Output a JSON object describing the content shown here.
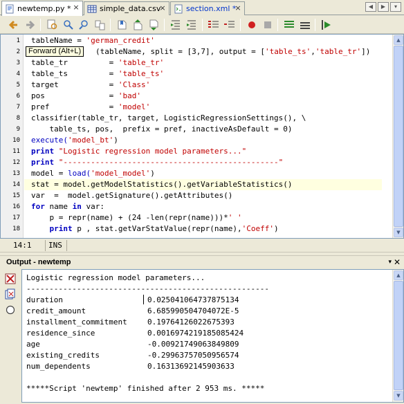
{
  "tabs": [
    {
      "label": "newtemp.py *",
      "icon": "python-file-icon"
    },
    {
      "label": "simple_data.csv",
      "icon": "table-file-icon"
    },
    {
      "label": "section.xml *",
      "icon": "xml-file-icon"
    }
  ],
  "tab_nav": {
    "prev": "◀",
    "next": "▶",
    "list": "▾"
  },
  "tooltip": "Forward (Alt+L)",
  "line_numbers": [
    "1",
    "2",
    "3",
    "4",
    "5",
    "6",
    "7",
    "8",
    "9",
    "10",
    "11",
    "12",
    "13",
    "14",
    "15",
    "16",
    "17",
    "18"
  ],
  "code": {
    "l1a": "tableName = ",
    "l1b": "'german_credit'",
    "l2a": "(tableName, split = [3,7], output = [",
    "l2b": "'table_ts'",
    "l2c": ",",
    "l2d": "'table_tr'",
    "l2e": "])",
    "l3a": "table_tr         = ",
    "l3b": "'table_tr'",
    "l4a": "table_ts         = ",
    "l4b": "'table_ts'",
    "l5a": "target           = ",
    "l5b": "'Class'",
    "l6a": "pos              = ",
    "l6b": "'bad'",
    "l7a": "pref             = ",
    "l7b": "'model'",
    "l8": "classifier(table_tr, target, LogisticRegressionSettings(), \\",
    "l9": "    table_ts, pos,  prefix = pref, inactiveAsDefault = 0)",
    "l10a": "execute(",
    "l10b": "'model_bt'",
    "l10c": ")",
    "l11a": "print",
    "l11b": " ",
    "l11c": "\"Logistic regression model parameters...\"",
    "l12a": "print",
    "l12b": " ",
    "l12c": "\"-----------------------------------------------\"",
    "l13a": "model = ",
    "l13b": "load(",
    "l13c": "'model_model'",
    "l13d": ")",
    "l14": "stat = model.getModelStatistics().getVariableStatistics()",
    "l15": "var  =  model.getSignature().getAttributes()",
    "l16a": "for",
    "l16b": " name ",
    "l16c": "in",
    "l16d": " var:",
    "l17a": "    p = repr(name) + (24 -len(repr(name)))*",
    "l17b": "' '",
    "l18a": "    print",
    "l18b": " p , stat.getVarStatValue(repr(name),",
    "l18c": "'Coeff'",
    "l18d": ")"
  },
  "status": {
    "position": "14:1",
    "mode": "INS"
  },
  "output": {
    "title": "Output - newtemp",
    "menu_icon": "▾",
    "close_icon": "✕",
    "header": "Logistic regression model parameters...",
    "separator": "-----------------------------------------------------",
    "rows": [
      {
        "name": "duration",
        "value": "0.025041064737875134"
      },
      {
        "name": "credit_amount",
        "value": "6.685990504704072E-5"
      },
      {
        "name": "installment_commitment",
        "value": "0.19764126022675393"
      },
      {
        "name": "residence_since",
        "value": "0.0016974219185085424"
      },
      {
        "name": "age",
        "value": "-0.00921749063849809"
      },
      {
        "name": "existing_credits",
        "value": "-0.29963757050956574"
      },
      {
        "name": "num_dependents",
        "value": "0.16313692145903633"
      }
    ],
    "footer": "*****Script 'newtemp' finished after 2 953 ms. *****"
  }
}
